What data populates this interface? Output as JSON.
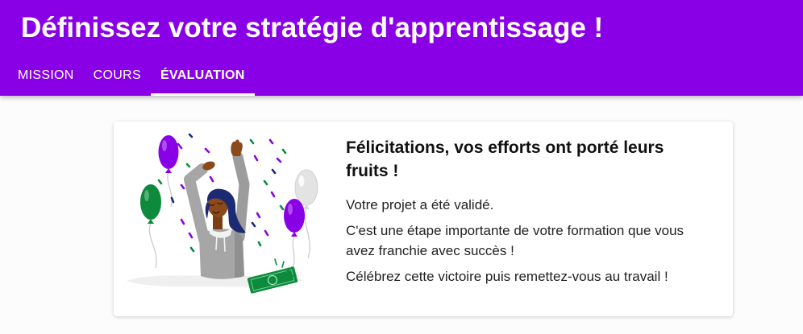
{
  "page": {
    "title": "Définissez votre stratégie d'apprentissage !"
  },
  "tabs": [
    {
      "label": "MISSION",
      "active": false
    },
    {
      "label": "COURS",
      "active": false
    },
    {
      "label": "ÉVALUATION",
      "active": true
    }
  ],
  "result_card": {
    "illustration": "celebration-illustration",
    "heading": "Félicitations, vos efforts ont porté leurs fruits !",
    "paragraphs": [
      "Votre projet a été validé.",
      "C'est une étape importante de votre formation que vous avez franchie avec succès !",
      "Célébrez cette victoire puis remettez-vous au travail !"
    ]
  },
  "colors": {
    "brand_purple": "#8a00e6",
    "header_text": "#ffffff",
    "heading_text": "#111111",
    "body_text": "#222222",
    "illustration_green": "#0d8a3c",
    "illustration_navy": "#1c2a73"
  }
}
